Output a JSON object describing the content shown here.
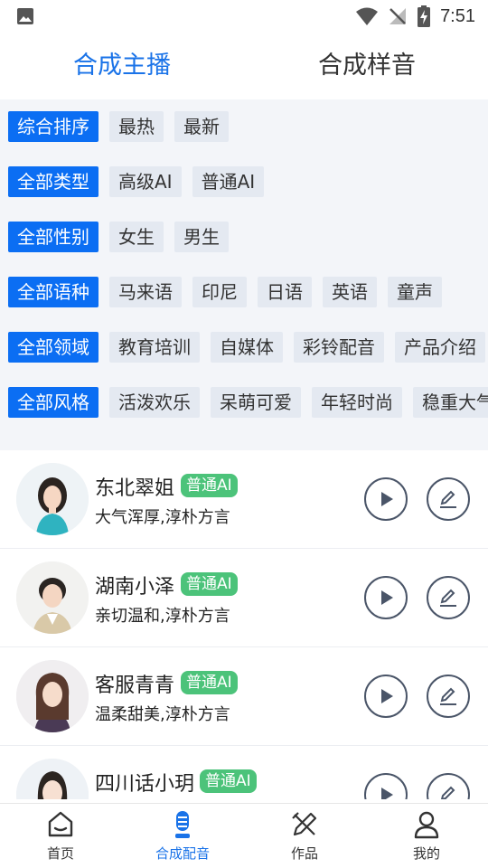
{
  "status_bar": {
    "time": "7:51"
  },
  "top_tabs": [
    {
      "label": "合成主播",
      "active": true
    },
    {
      "label": "合成样音",
      "active": false
    }
  ],
  "filters": [
    {
      "chips": [
        "综合排序",
        "最热",
        "最新"
      ]
    },
    {
      "chips": [
        "全部类型",
        "高级AI",
        "普通AI"
      ]
    },
    {
      "chips": [
        "全部性别",
        "女生",
        "男生"
      ]
    },
    {
      "chips": [
        "全部语种",
        "马来语",
        "印尼",
        "日语",
        "英语",
        "童声"
      ]
    },
    {
      "chips": [
        "全部领域",
        "教育培训",
        "自媒体",
        "彩铃配音",
        "产品介绍"
      ]
    },
    {
      "chips": [
        "全部风格",
        "活泼欢乐",
        "呆萌可爱",
        "年轻时尚",
        "稳重大气"
      ]
    }
  ],
  "voices": [
    {
      "name": "东北翠姐",
      "badge": "普通AI",
      "desc": "大气浑厚,淳朴方言"
    },
    {
      "name": "湖南小泽",
      "badge": "普通AI",
      "desc": "亲切温和,淳朴方言"
    },
    {
      "name": "客服青青",
      "badge": "普通AI",
      "desc": "温柔甜美,淳朴方言"
    },
    {
      "name": "四川话小玥",
      "badge": "普通AI",
      "desc": ""
    }
  ],
  "bottom_nav": [
    {
      "label": "首页",
      "icon": "home-icon",
      "active": false
    },
    {
      "label": "合成配音",
      "icon": "microphone-icon",
      "active": true
    },
    {
      "label": "作品",
      "icon": "works-icon",
      "active": false
    },
    {
      "label": "我的",
      "icon": "profile-icon",
      "active": false
    }
  ],
  "colors": {
    "accent": "#1a73e8",
    "chip_selected": "#0b6ef3",
    "badge": "#4cc37a",
    "panel": "#f3f5f9"
  }
}
